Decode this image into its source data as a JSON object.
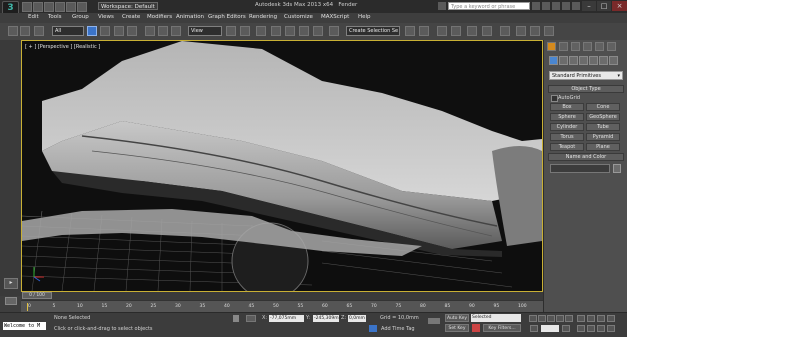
{
  "title_bar": {
    "workspace": "Workspace: Default",
    "title": "Autodesk 3ds Max 2013 x64",
    "filename": "Fender",
    "search_placeholder": "Type a keyword or phrase"
  },
  "menus": [
    "Edit",
    "Tools",
    "Group",
    "Views",
    "Create",
    "Modifiers",
    "Animation",
    "Graph Editors",
    "Rendering",
    "Customize",
    "MAXScript",
    "Help"
  ],
  "toolbar": {
    "selection_filter": "All",
    "reference_coord": "View",
    "named_selection": "Create Selection Se"
  },
  "viewport": {
    "label": "[ + ] [Perspective ] [Realistic ]"
  },
  "command_panel": {
    "category_dropdown": "Standard Primitives",
    "object_type_header": "Object Type",
    "autogrid_label": "AutoGrid",
    "object_buttons": [
      "Box",
      "Cone",
      "Sphere",
      "GeoSphere",
      "Cylinder",
      "Tube",
      "Torus",
      "Pyramid",
      "Teapot",
      "Plane"
    ],
    "name_color_header": "Name and Color"
  },
  "timeline": {
    "frame_display": "0 / 100",
    "ruler_ticks": [
      "0",
      "5",
      "10",
      "15",
      "20",
      "25",
      "30",
      "35",
      "40",
      "45",
      "50",
      "55",
      "60",
      "65",
      "70",
      "75",
      "80",
      "85",
      "90",
      "95",
      "100"
    ]
  },
  "status_bar": {
    "listener_text": "Welcome to M",
    "selection_status": "None Selected",
    "prompt": "Click or click-and-drag to select objects",
    "x_label": "X:",
    "x_value": "-77,075mm",
    "y_label": "Y:",
    "y_value": "-245,309mm",
    "z_label": "Z:",
    "z_value": "0,0mm",
    "grid": "Grid = 10,0mm",
    "add_time_tag": "Add Time Tag",
    "auto_key": "Auto Key",
    "set_key": "Set Key",
    "key_mode": "Selected",
    "key_filters": "Key Filters..."
  },
  "colors": {
    "viewport_border": "#c9b034",
    "ui_background": "#4a4a4a",
    "active_tool": "#3b74c9",
    "grid_line": "#7a7a7a",
    "mesh_light": "#d0d0d0"
  }
}
